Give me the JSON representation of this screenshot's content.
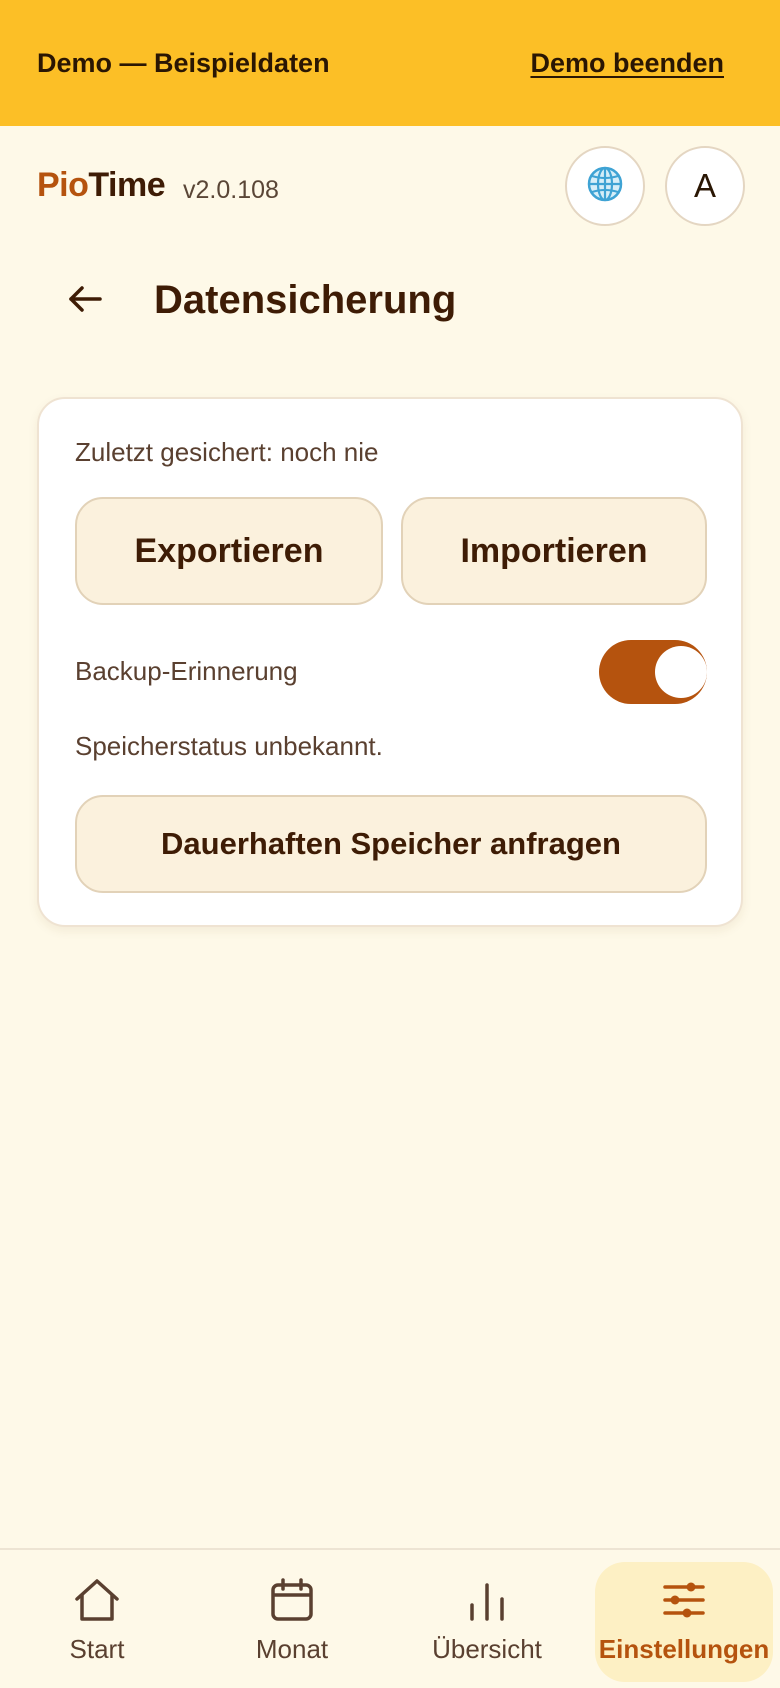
{
  "banner": {
    "text": "Demo — Beispieldaten",
    "exit_label": "Demo beenden"
  },
  "header": {
    "brand_part1": "Pio",
    "brand_part2": "Time",
    "version": "v2.0.108",
    "language_icon": "globe-icon",
    "avatar_initial": "A"
  },
  "page": {
    "title": "Datensicherung",
    "back_icon": "arrow-left-icon"
  },
  "backup_card": {
    "last_backup": "Zuletzt gesichert: noch nie",
    "export_label": "Exportieren",
    "import_label": "Importieren",
    "reminder_label": "Backup-Erinnerung",
    "reminder_enabled": true,
    "storage_status": "Speicherstatus unbekannt.",
    "persist_label": "Dauerhaften Speicher anfragen"
  },
  "nav": {
    "items": [
      {
        "label": "Start",
        "icon": "home-icon",
        "active": false
      },
      {
        "label": "Monat",
        "icon": "calendar-icon",
        "active": false
      },
      {
        "label": "Übersicht",
        "icon": "bar-chart-icon",
        "active": false
      },
      {
        "label": "Einstellungen",
        "icon": "sliders-icon",
        "active": true
      }
    ]
  },
  "colors": {
    "banner": "#FCBF26",
    "accent": "#B5530E",
    "background": "#FEF9E8",
    "button_bg": "#FBF1DD",
    "active_nav_bg": "#FDF0C4"
  }
}
